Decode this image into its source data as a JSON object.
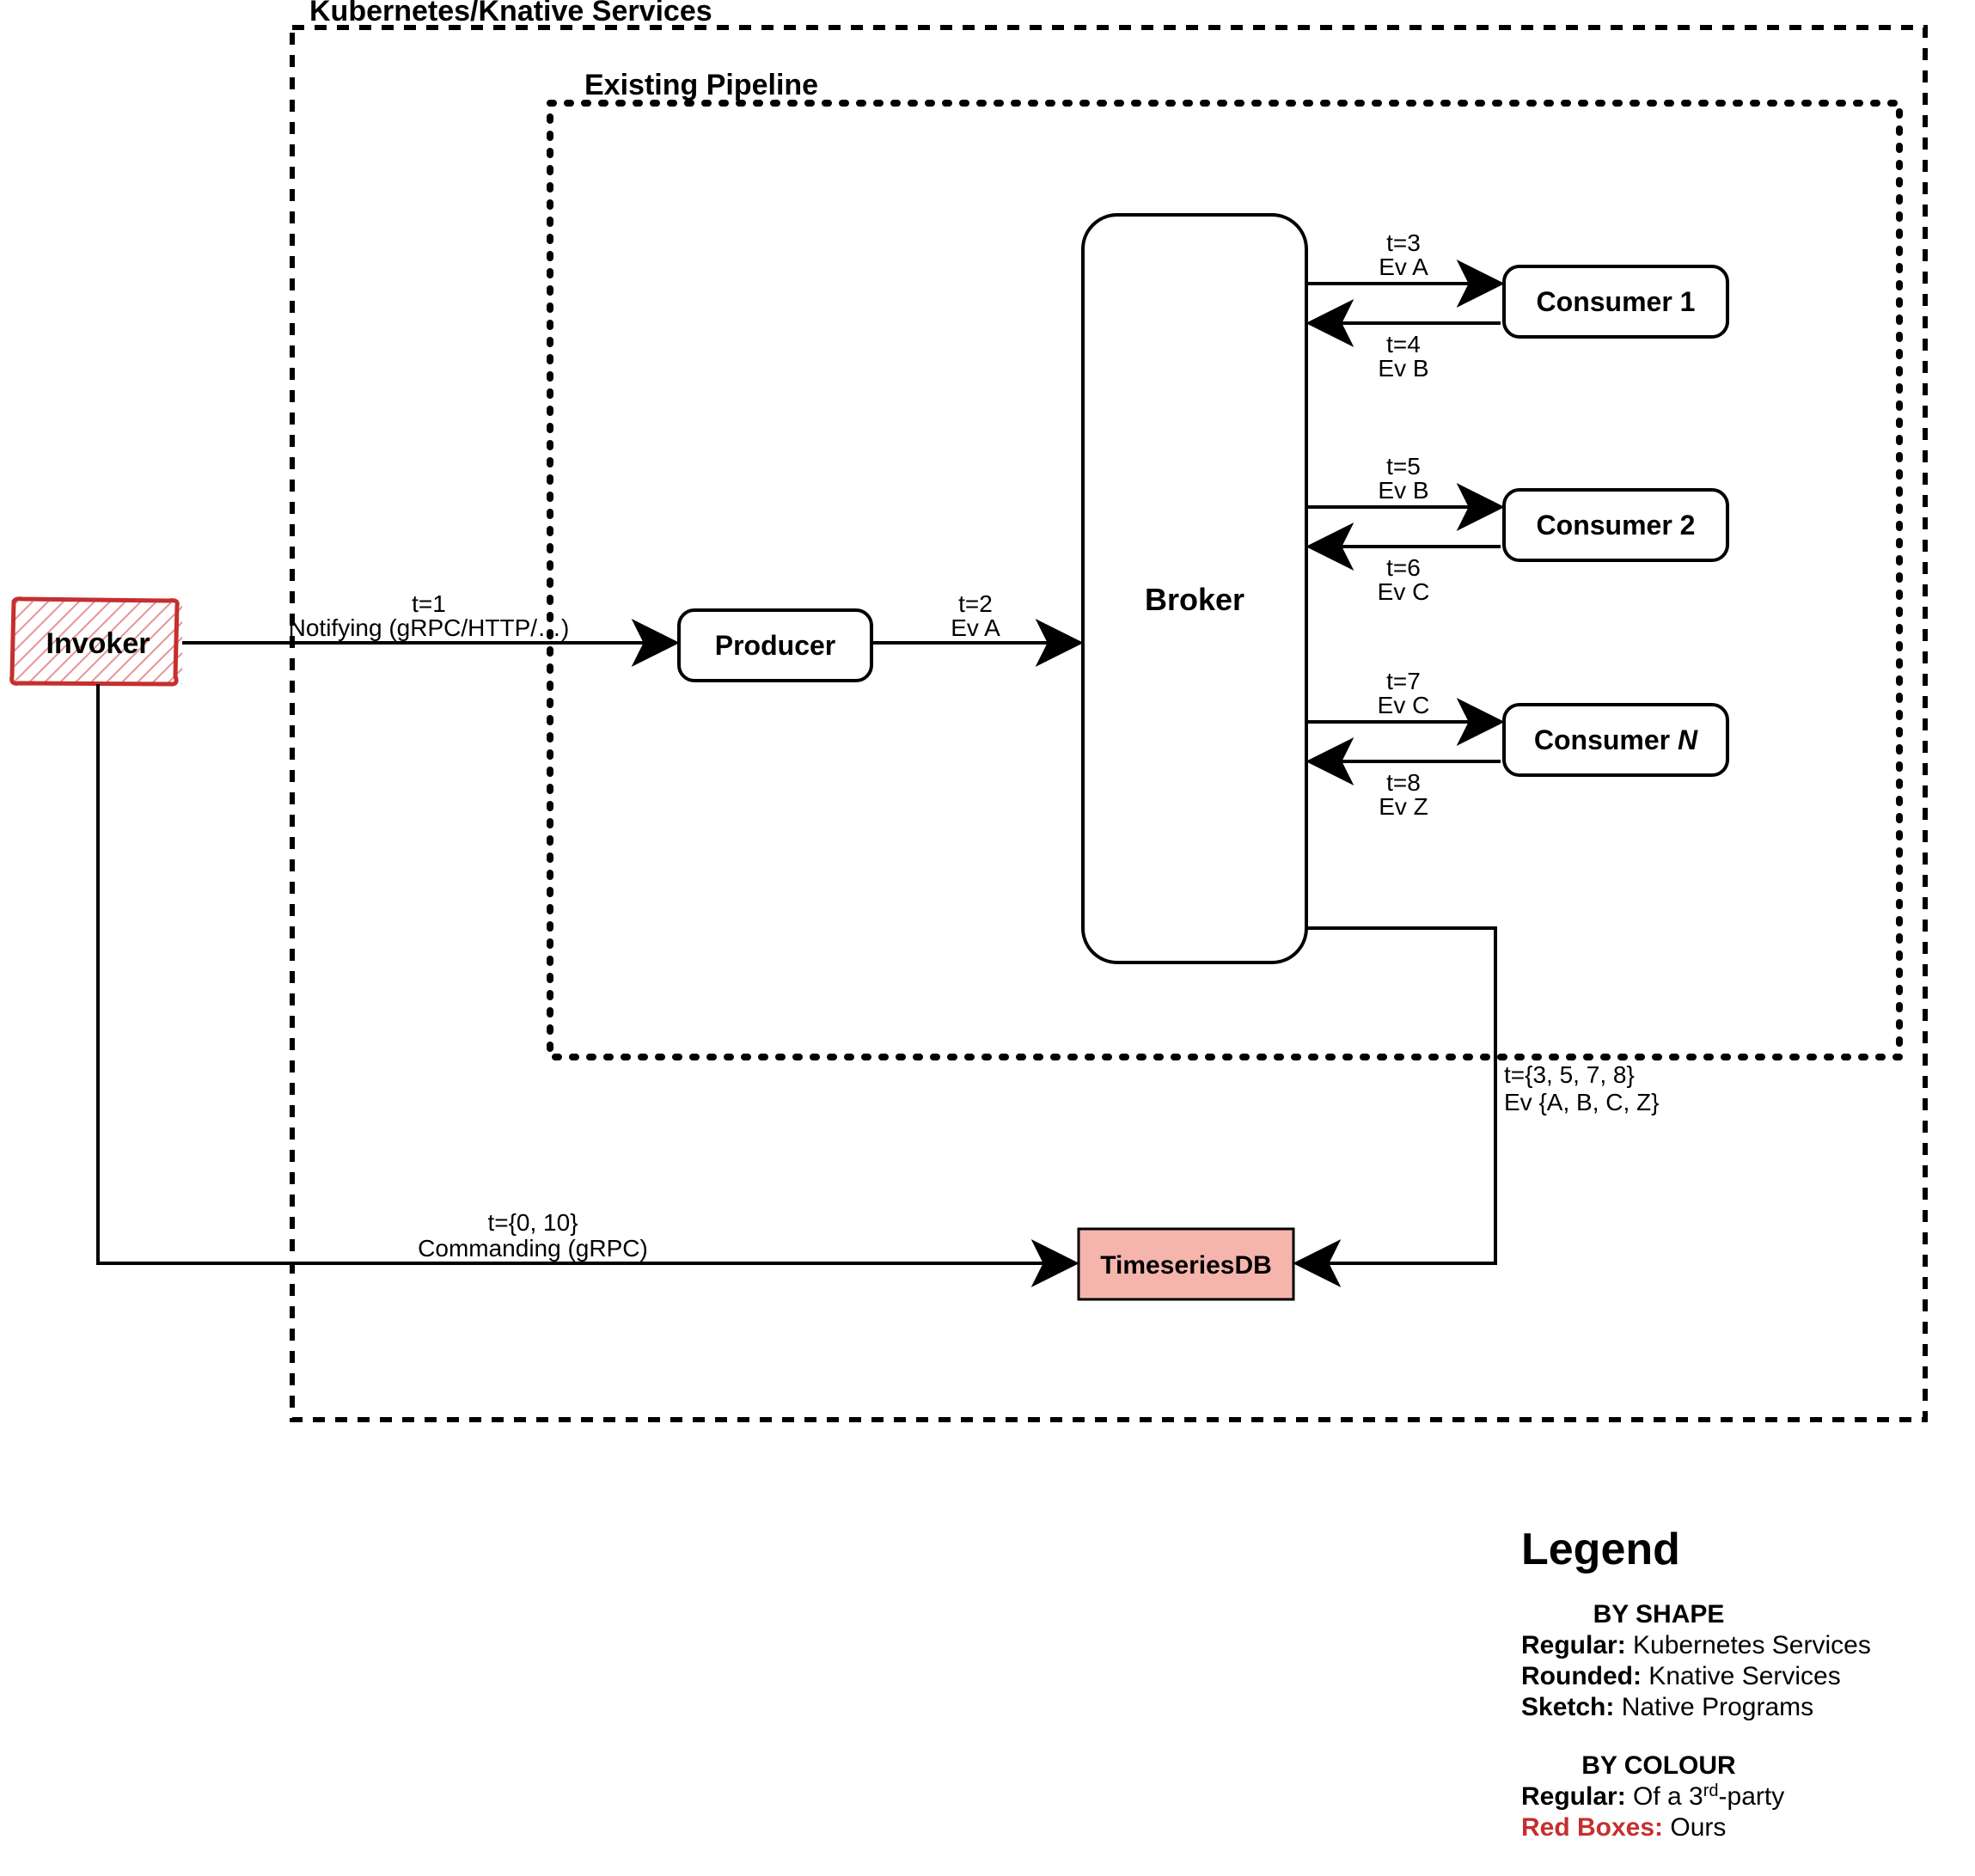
{
  "containers": {
    "outer_title": "Kubernetes/Knative Services",
    "inner_title": "Existing Pipeline"
  },
  "nodes": {
    "invoker": "Invoker",
    "producer": "Producer",
    "broker": "Broker",
    "consumer1": "Consumer 1",
    "consumer2": "Consumer 2",
    "consumerN_prefix": "Consumer ",
    "consumerN_italic": "N",
    "tsdb": "TimeseriesDB"
  },
  "edges": {
    "notify_top": "t=1",
    "notify_bottom": "Notifying (gRPC/HTTP/…)",
    "prod_to_broker_top": "t=2",
    "prod_to_broker_bottom": "Ev A",
    "c1_fwd_top": "t=3",
    "c1_fwd_bottom": "Ev A",
    "c1_back_top": "t=4",
    "c1_back_bottom": "Ev B",
    "c2_fwd_top": "t=5",
    "c2_fwd_bottom": "Ev B",
    "c2_back_top": "t=6",
    "c2_back_bottom": "Ev C",
    "cN_fwd_top": "t=7",
    "cN_fwd_bottom": "Ev C",
    "cN_back_top": "t=8",
    "cN_back_bottom": "Ev Z",
    "broker_to_tsdb_top": "t={3, 5, 7, 8}",
    "broker_to_tsdb_bottom": "Ev {A, B, C, Z}",
    "invoker_to_tsdb_top": "t={0, 10}",
    "invoker_to_tsdb_bottom": "Commanding (gRPC)"
  },
  "legend": {
    "title": "Legend",
    "by_shape_title": "BY SHAPE",
    "regular_shape_key": "Regular:",
    "regular_shape_val": " Kubernetes Services",
    "rounded_key": "Rounded:",
    "rounded_val": " Knative Services",
    "sketch_key": "Sketch:",
    "sketch_val": " Native Programs",
    "by_colour_title": "BY COLOUR",
    "regular_colour_key": "Regular:",
    "regular_colour_val_pre": " Of a 3",
    "regular_colour_val_sup": "rd",
    "regular_colour_val_post": "-party",
    "red_key": "Red Boxes:",
    "red_val": " Ours"
  }
}
